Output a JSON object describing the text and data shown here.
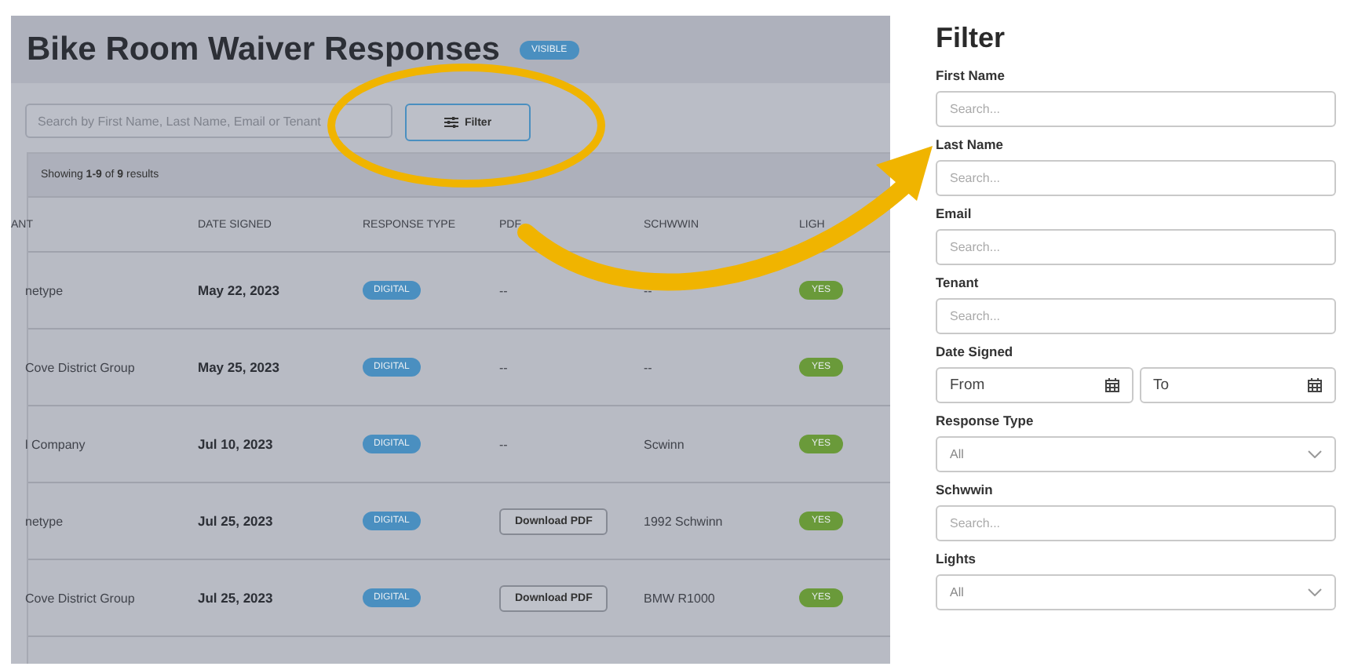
{
  "page": {
    "title": "Bike Room Waiver Responses",
    "status_badge": "VISIBLE",
    "search": {
      "placeholder": "Search by First Name, Last Name, Email or Tenant"
    },
    "filter_button": "Filter",
    "results": "Showing **1-9** of **9** results",
    "table": {
      "columns": [
        "ANT",
        "DATE SIGNED",
        "RESPONSE TYPE",
        "PDF",
        "SCHWWIN",
        "LIGH"
      ],
      "rows": [
        {
          "tenant": "netype",
          "date": "May 22, 2023",
          "response_type": "DIGITAL",
          "pdf": {
            "kind": "text",
            "text": "--"
          },
          "schwwin": "--",
          "lights": "YES"
        },
        {
          "tenant": "Cove District Group",
          "date": "May 25, 2023",
          "response_type": "DIGITAL",
          "pdf": {
            "kind": "text",
            "text": "--"
          },
          "schwwin": "--",
          "lights": "YES"
        },
        {
          "tenant": "l Company",
          "date": "Jul 10, 2023",
          "response_type": "DIGITAL",
          "pdf": {
            "kind": "text",
            "text": "--"
          },
          "schwwin": "Scwinn",
          "lights": "YES"
        },
        {
          "tenant": "netype",
          "date": "Jul 25, 2023",
          "response_type": "DIGITAL",
          "pdf": {
            "kind": "button",
            "text": "Download PDF"
          },
          "schwwin": "1992 Schwinn",
          "lights": "YES"
        },
        {
          "tenant": "Cove District Group",
          "date": "Jul 25, 2023",
          "response_type": "DIGITAL",
          "pdf": {
            "kind": "button",
            "text": "Download PDF"
          },
          "schwwin": "BMW R1000",
          "lights": "YES"
        }
      ]
    }
  },
  "filter_panel": {
    "title": "Filter",
    "fields": [
      {
        "kind": "text",
        "label": "First Name",
        "placeholder": "Search..."
      },
      {
        "kind": "text",
        "label": "Last Name",
        "placeholder": "Search..."
      },
      {
        "kind": "text",
        "label": "Email",
        "placeholder": "Search..."
      },
      {
        "kind": "text",
        "label": "Tenant",
        "placeholder": "Search..."
      },
      {
        "kind": "date_range",
        "label": "Date Signed",
        "from": "From",
        "to": "To"
      },
      {
        "kind": "select",
        "label": "Response Type",
        "value": "All"
      },
      {
        "kind": "text",
        "label": "Schwwin",
        "placeholder": "Search..."
      },
      {
        "kind": "select",
        "label": "Lights",
        "value": "All"
      }
    ]
  }
}
